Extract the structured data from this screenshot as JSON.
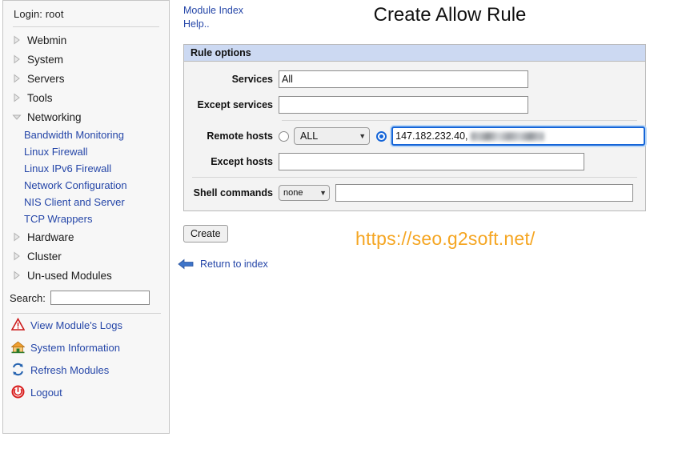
{
  "sidebar": {
    "login_label": "Login: root",
    "tree": [
      {
        "label": "Webmin",
        "expanded": false
      },
      {
        "label": "System",
        "expanded": false
      },
      {
        "label": "Servers",
        "expanded": false
      },
      {
        "label": "Tools",
        "expanded": false
      },
      {
        "label": "Networking",
        "expanded": true
      }
    ],
    "networking_children": [
      "Bandwidth Monitoring",
      "Linux Firewall",
      "Linux IPv6 Firewall",
      "Network Configuration",
      "NIS Client and Server",
      "TCP Wrappers"
    ],
    "tree_after": [
      {
        "label": "Hardware",
        "expanded": false
      },
      {
        "label": "Cluster",
        "expanded": false
      },
      {
        "label": "Un-used Modules",
        "expanded": false
      }
    ],
    "search": {
      "label": "Search:",
      "value": "",
      "placeholder": ""
    },
    "tools": [
      {
        "label": "View Module's Logs",
        "icon": "warning-triangle-icon"
      },
      {
        "label": "System Information",
        "icon": "home-icon"
      },
      {
        "label": "Refresh Modules",
        "icon": "refresh-icon"
      },
      {
        "label": "Logout",
        "icon": "power-icon"
      }
    ]
  },
  "main": {
    "module_index_link": "Module Index",
    "help_link": "Help..",
    "page_title": "Create Allow Rule",
    "panel_header": "Rule options",
    "fields": {
      "services_label": "Services",
      "services_value": "All",
      "except_services_label": "Except services",
      "except_services_value": "",
      "remote_hosts_label": "Remote hosts",
      "remote_hosts_select": "ALL",
      "remote_hosts_value": "147.182.232.40, ",
      "except_hosts_label": "Except hosts",
      "except_hosts_value": "",
      "shell_commands_label": "Shell commands",
      "shell_commands_select": "none",
      "shell_commands_value": ""
    },
    "create_button": "Create",
    "return_link": "Return to index",
    "watermark": "https://seo.g2soft.net/"
  },
  "colors": {
    "link": "#2546a8",
    "panel_header_bg": "#ccd9f2",
    "focus_border": "#1565d8",
    "watermark": "#f5a623"
  }
}
